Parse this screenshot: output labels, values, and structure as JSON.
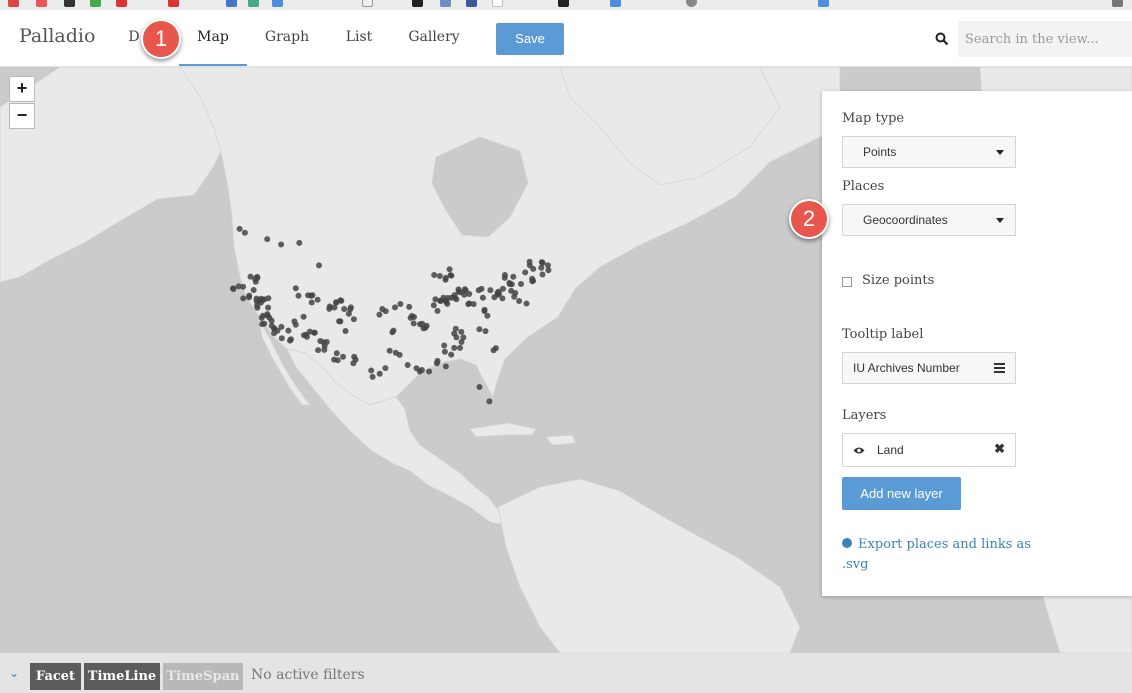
{
  "brand": "Palladio",
  "nav": {
    "tabs": [
      {
        "label": "D"
      },
      {
        "label": "Map"
      },
      {
        "label": "Graph"
      },
      {
        "label": "List"
      },
      {
        "label": "Gallery"
      }
    ],
    "active_tab": "Map",
    "save_label": "Save"
  },
  "search": {
    "placeholder": "Search in the view..."
  },
  "callouts": [
    "1",
    "2"
  ],
  "map": {
    "zoom_in": "+",
    "zoom_out": "−"
  },
  "panel": {
    "map_type_label": "Map type",
    "map_type_value": "Points",
    "places_label": "Places",
    "places_value": "Geocoordinates",
    "size_points_label": "Size points",
    "size_points_checked": false,
    "tooltip_label": "Tooltip label",
    "tooltip_value": "IU Archives Number",
    "layers_label": "Layers",
    "layers": [
      {
        "name": "Land",
        "visible": true
      }
    ],
    "add_layer_label": "Add new layer",
    "export_label": "Export places and links as .svg"
  },
  "filterbar": {
    "facet_label": "Facet",
    "timeline_label": "TimeLine",
    "timespan_label": "TimeSpan",
    "status": "No active filters"
  },
  "colors": {
    "accent": "#5b9bd5",
    "callout": "#e8574e",
    "land": "#e9e9e9",
    "water": "#cbcbcb",
    "point": "#444444",
    "link": "#3b82b8"
  }
}
